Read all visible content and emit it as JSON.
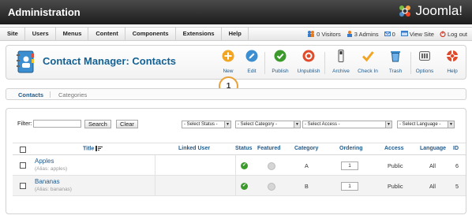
{
  "header": {
    "title": "Administration",
    "logo_text": "Joomla!"
  },
  "menu": {
    "items": [
      "Site",
      "Users",
      "Menus",
      "Content",
      "Components",
      "Extensions",
      "Help"
    ]
  },
  "status": {
    "visitors": "0 Visitors",
    "admins": "3 Admins",
    "messages": "0",
    "view_site": "View Site",
    "logout": "Log out"
  },
  "toolbar": {
    "title": "Contact Manager: Contacts",
    "buttons": [
      "New",
      "Edit",
      "Publish",
      "Unpublish",
      "Archive",
      "Check In",
      "Trash",
      "Options",
      "Help"
    ]
  },
  "callout": "1",
  "subnav": {
    "tabs": [
      "Contacts",
      "Categories"
    ]
  },
  "filter": {
    "label": "Filter:",
    "value": "",
    "search_label": "Search",
    "clear_label": "Clear",
    "status_select": "- Select Status -",
    "category_select": "- Select Category -",
    "access_select": "- Select Access -",
    "language_select": "- Select Language -"
  },
  "table": {
    "headers": [
      "Title",
      "Linked User",
      "Status",
      "Featured",
      "Category",
      "Ordering",
      "Access",
      "Language",
      "ID"
    ],
    "rows": [
      {
        "title": "Apples",
        "alias": "(Alias: apples)",
        "linked_user": "",
        "category": "A",
        "ordering": "1",
        "access": "Public",
        "language": "All",
        "id": "6"
      },
      {
        "title": "Bananas",
        "alias": "(Alias: bananas)",
        "linked_user": "",
        "category": "B",
        "ordering": "1",
        "access": "Public",
        "language": "All",
        "id": "5"
      }
    ]
  },
  "colors": {
    "accent": "#1f5a8c",
    "header_bg": "#2b2b2b",
    "callout": "#e8a23b"
  }
}
